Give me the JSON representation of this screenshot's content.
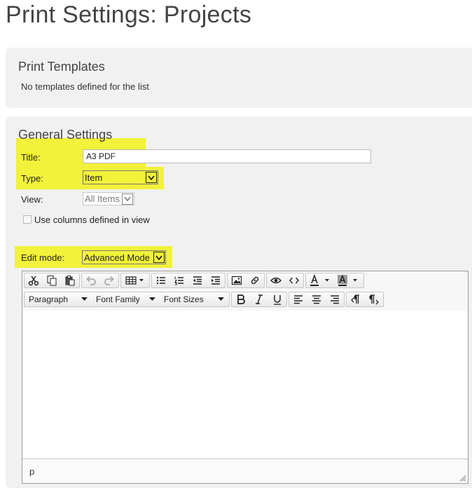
{
  "page": {
    "title": "Print Settings: Projects"
  },
  "templates": {
    "heading": "Print Templates",
    "empty_message": "No templates defined for the list"
  },
  "general": {
    "heading": "General Settings",
    "title_label": "Title:",
    "title_value": "A3 PDF",
    "type_label": "Type:",
    "type_value": "Item",
    "view_label": "View:",
    "view_value": "All Items",
    "use_columns_label": "Use columns defined in view",
    "use_columns_checked": false,
    "edit_mode_label": "Edit mode:",
    "edit_mode_value": "Advanced Mode",
    "highlight_color": "#f2f23a"
  },
  "editor": {
    "paragraph_label": "Paragraph",
    "font_family_label": "Font Family",
    "font_sizes_label": "Font Sizes",
    "status_path": "p",
    "icons": [
      "cut-icon",
      "copy-icon",
      "paste-icon",
      "undo-icon",
      "redo-icon",
      "table-icon",
      "bullet-list-icon",
      "numbered-list-icon",
      "outdent-icon",
      "indent-icon",
      "image-icon",
      "link-icon",
      "preview-icon",
      "source-code-icon",
      "text-color-icon",
      "background-color-icon",
      "bold-icon",
      "italic-icon",
      "underline-icon",
      "align-left-icon",
      "align-center-icon",
      "align-right-icon",
      "ltr-icon",
      "rtl-icon"
    ]
  }
}
